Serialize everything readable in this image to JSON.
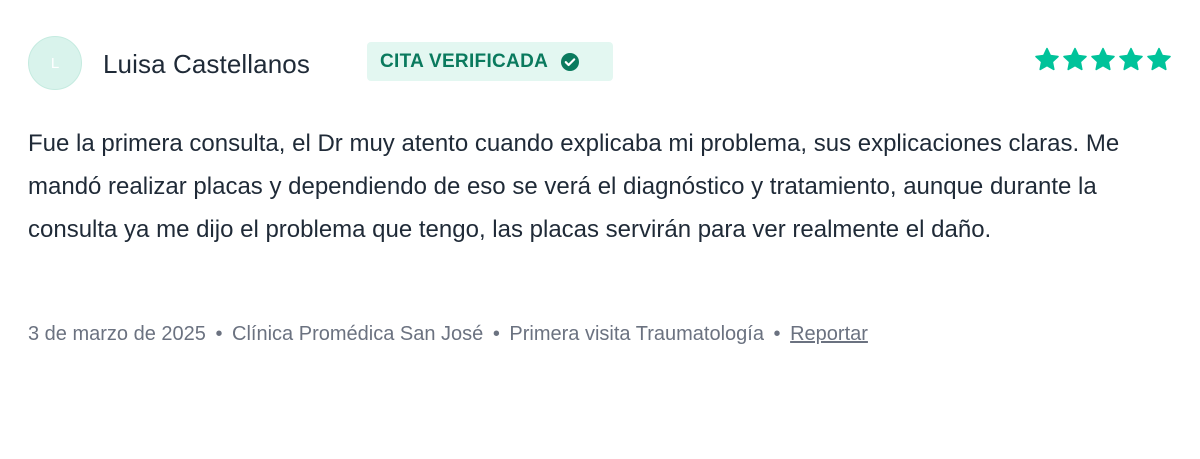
{
  "review": {
    "avatar_initial": "L",
    "author_name": "Luisa Castellanos",
    "badge": {
      "label": "CITA VERIFICADA",
      "icon": "check-circle-icon"
    },
    "rating": 5,
    "rating_max": 5,
    "text": "Fue la primera consulta, el Dr muy atento cuando explicaba mi problema, sus explicaciones claras. Me mandó realizar placas y dependiendo de eso se verá el diagnóstico y tratamiento, aunque durante la consulta ya me dijo el problema que tengo, las placas servirán para ver realmente el daño.",
    "meta": {
      "date": "3 de marzo de 2025",
      "clinic": "Clínica Promédica San José",
      "visit_type": "Primera visita Traumatología",
      "separator": "•",
      "report_label": "Reportar"
    }
  },
  "colors": {
    "accent": "#00c39a",
    "badge_bg": "#e3f7f1",
    "badge_text": "#0a7a5e",
    "text": "#1f2a37",
    "muted": "#6b7280"
  }
}
